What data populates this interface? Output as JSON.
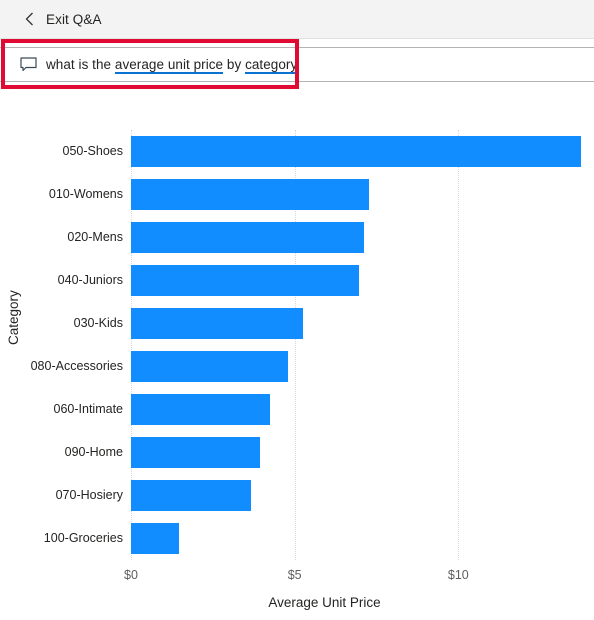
{
  "header": {
    "back_icon": "chevron-left-icon",
    "exit_label": "Exit Q&A"
  },
  "question_box": {
    "icon": "speech-bubble-icon",
    "prefix": "what is the ",
    "term1": "average unit price",
    "middle": " by ",
    "term2": "category",
    "full_text": "what is the average unit price by category",
    "term_underline_color": "#0a72d1",
    "highlight_border_color": "#e00b33"
  },
  "chart_data": {
    "type": "bar",
    "orientation": "horizontal",
    "title": "",
    "subtitle": "",
    "xlabel": "Average Unit Price",
    "ylabel": "Category",
    "categories": [
      "050-Shoes",
      "010-Womens",
      "020-Mens",
      "040-Juniors",
      "030-Kids",
      "080-Accessories",
      "060-Intimate",
      "090-Home",
      "070-Hosiery",
      "100-Groceries"
    ],
    "values": [
      13.74,
      7.28,
      7.13,
      6.98,
      5.26,
      4.8,
      4.26,
      3.93,
      3.66,
      1.48
    ],
    "series": [
      {
        "name": "Average Unit Price",
        "values": [
          13.74,
          7.28,
          7.13,
          6.98,
          5.26,
          4.8,
          4.26,
          3.93,
          3.66,
          1.48
        ]
      }
    ],
    "xlim": [
      0,
      13.74
    ],
    "xticks": [
      0,
      5,
      10
    ],
    "xtick_labels": [
      "$0",
      "$5",
      "$10"
    ],
    "grid": "vertical-dotted",
    "legend": "none",
    "bar_color": "#118dff",
    "gridline_color": "#d9d9d9"
  }
}
